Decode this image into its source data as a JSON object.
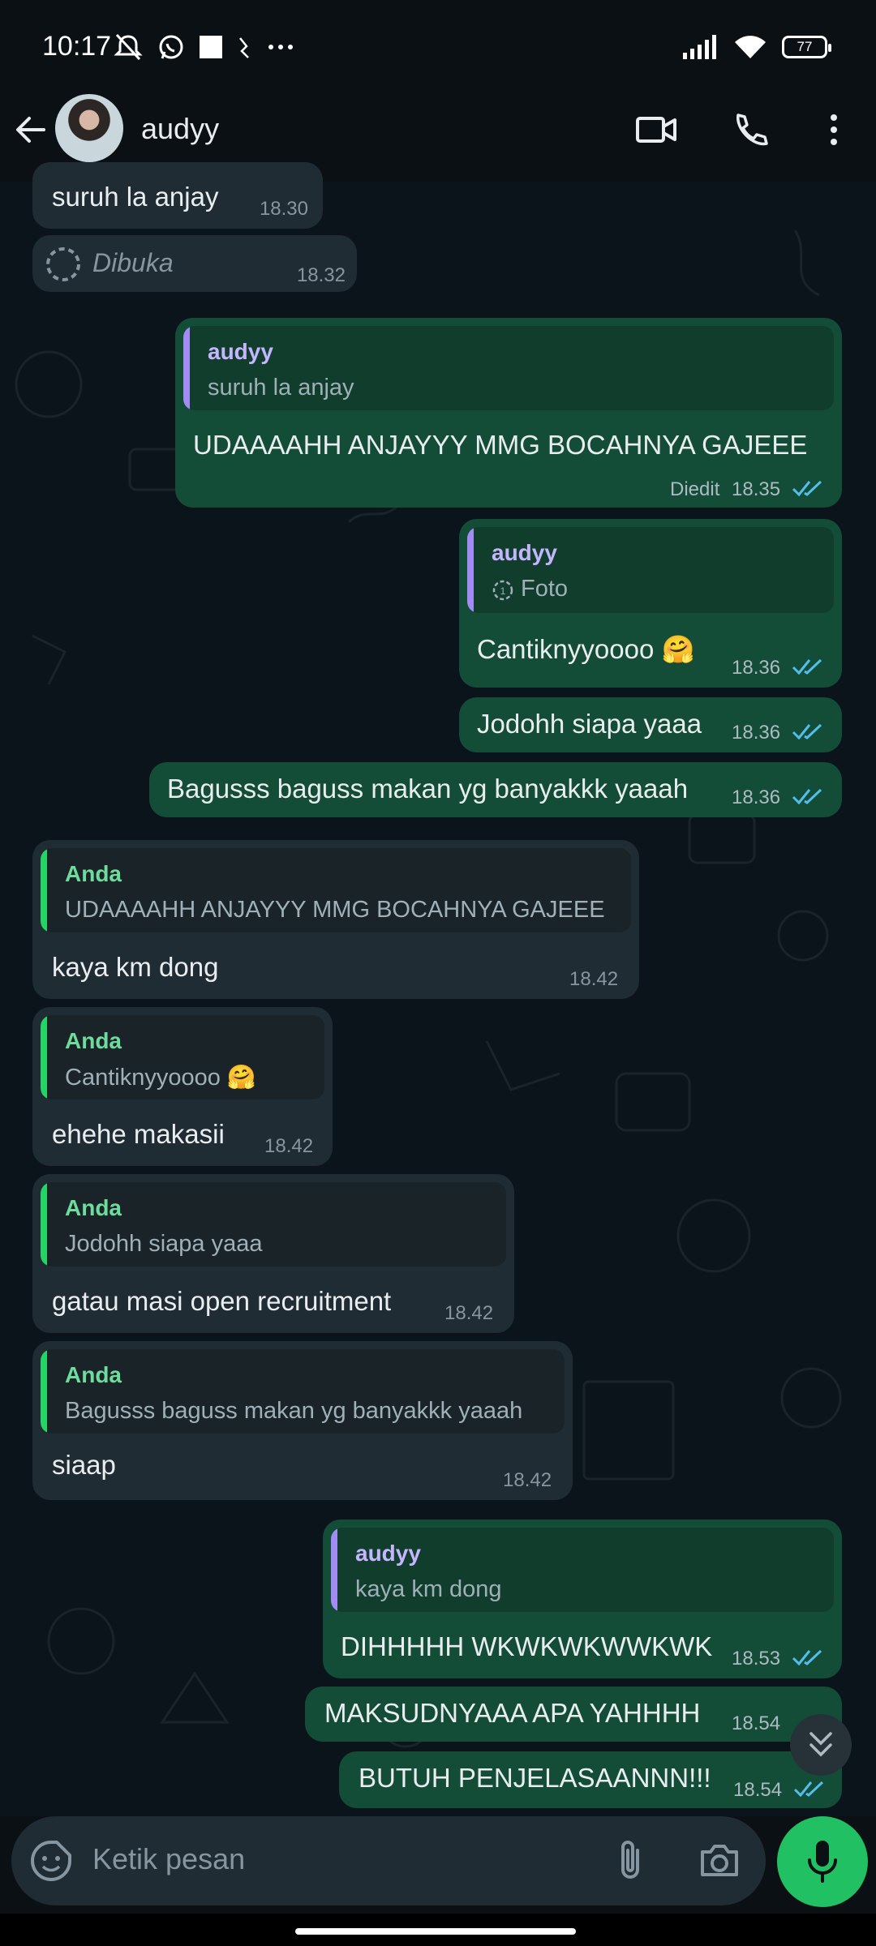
{
  "status_bar": {
    "time": "10:17",
    "battery": "77"
  },
  "header": {
    "contact_name": "audyy",
    "avatar_icon": "avatar-photo"
  },
  "colors": {
    "incoming": "#202c33",
    "outgoing": "#134d37",
    "accent_green": "#21c063",
    "tick_blue": "#53bdeb",
    "quote_self": "#25d366",
    "quote_other": "#a28cf4"
  },
  "messages": [
    {
      "dir": "in",
      "text": "suruh la anjay",
      "time": "18.30"
    },
    {
      "dir": "in",
      "text": "Dibuka",
      "time": "18.32",
      "type": "view-once"
    },
    {
      "dir": "out",
      "quote_name": "audyy",
      "quote_text": "suruh la anjay",
      "text": "UDAAAAHH ANJAYYY MMG BOCAHNYA GAJEEE",
      "edited": "Diedit",
      "time": "18.35"
    },
    {
      "dir": "out",
      "quote_name": "audyy",
      "quote_text": "Foto",
      "text": "Cantiknyyoooo 🤗",
      "time": "18.36"
    },
    {
      "dir": "out",
      "text": "Jodohh siapa yaaa",
      "time": "18.36"
    },
    {
      "dir": "out",
      "text": "Bagusss baguss makan yg banyakkk yaaah",
      "time": "18.36"
    },
    {
      "dir": "in",
      "quote_name": "Anda",
      "quote_text": "UDAAAAHH ANJAYYY MMG BOCAHNYA GAJEEE",
      "text": "kaya km dong",
      "time": "18.42"
    },
    {
      "dir": "in",
      "quote_name": "Anda",
      "quote_text": "Cantiknyyoooo 🤗",
      "text": "ehehe makasii",
      "time": "18.42"
    },
    {
      "dir": "in",
      "quote_name": "Anda",
      "quote_text": "Jodohh siapa yaaa",
      "text": "gatau masi open recruitment",
      "time": "18.42"
    },
    {
      "dir": "in",
      "quote_name": "Anda",
      "quote_text": "Bagusss baguss makan yg banyakkk yaaah",
      "text": "siaap",
      "time": "18.42"
    },
    {
      "dir": "out",
      "quote_name": "audyy",
      "quote_text": "kaya km dong",
      "text": "DIHHHHH WKWKWKWWKWK",
      "time": "18.53"
    },
    {
      "dir": "out",
      "text": "MAKSUDNYAAA APA YAHHHH",
      "time": "18.54"
    },
    {
      "dir": "out",
      "text": "BUTUH PENJELASAANNN!!!",
      "time": "18.54"
    }
  ],
  "composer": {
    "placeholder": "Ketik pesan"
  }
}
